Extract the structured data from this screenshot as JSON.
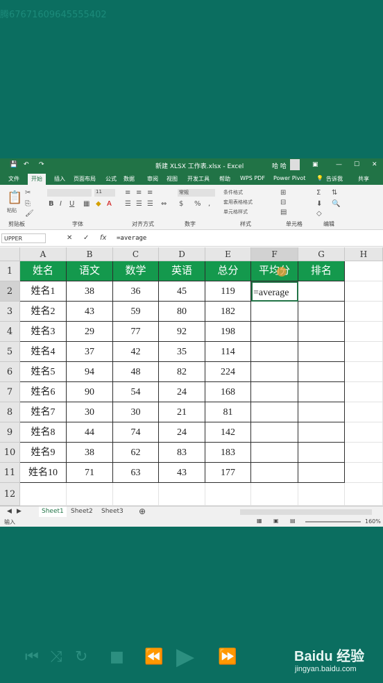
{
  "watermark_top": "腾6767160964555540​2",
  "window": {
    "title": "新建 XLSX 工作表.xlsx - Excel",
    "user": "哈 哈",
    "controls": [
      "—",
      "☐",
      "✕"
    ]
  },
  "ribbon_tabs": [
    "文件",
    "开始",
    "插入",
    "页面布局",
    "公式",
    "数据",
    "审阅",
    "视图",
    "开发工具",
    "帮助",
    "WPS PDF",
    "Power Pivot",
    "告诉我",
    "共享"
  ],
  "ribbon_groups": [
    "剪贴板",
    "字体",
    "对齐方式",
    "数字",
    "样式",
    "单元格",
    "编辑"
  ],
  "ribbon_misc": {
    "font_size": "11",
    "number_format": "常规",
    "conditional": "条件格式",
    "table_format": "套用表格格式",
    "cell_style": "单元格样式",
    "paste": "粘贴"
  },
  "formula_bar": {
    "name_box": "UPPER",
    "cancel": "✕",
    "enter": "✓",
    "fx": "fx",
    "content": "=average"
  },
  "columns": [
    "A",
    "B",
    "C",
    "D",
    "E",
    "F",
    "G",
    "H"
  ],
  "rows": [
    "1",
    "2",
    "3",
    "4",
    "5",
    "6",
    "7",
    "8",
    "9",
    "10",
    "11",
    "12"
  ],
  "table": {
    "headers": [
      "姓名",
      "语文",
      "数学",
      "英语",
      "总分",
      "平均分",
      "排名"
    ],
    "rows": [
      [
        "姓名1",
        "38",
        "36",
        "45",
        "119"
      ],
      [
        "姓名2",
        "43",
        "59",
        "80",
        "182"
      ],
      [
        "姓名3",
        "29",
        "77",
        "92",
        "198"
      ],
      [
        "姓名4",
        "37",
        "42",
        "35",
        "114"
      ],
      [
        "姓名5",
        "94",
        "48",
        "82",
        "224"
      ],
      [
        "姓名6",
        "90",
        "54",
        "24",
        "168"
      ],
      [
        "姓名7",
        "30",
        "30",
        "21",
        "81"
      ],
      [
        "姓名8",
        "44",
        "74",
        "24",
        "142"
      ],
      [
        "姓名9",
        "38",
        "62",
        "83",
        "183"
      ],
      [
        "姓名10",
        "71",
        "63",
        "43",
        "177"
      ]
    ],
    "editing_cell_text": "=average"
  },
  "sheet_tabs": [
    "Sheet1",
    "Sheet2",
    "Sheet3"
  ],
  "add_sheet": "⊕",
  "status": {
    "mode": "输入",
    "zoom": "160%"
  },
  "branding": {
    "logo": "Baidu 经验",
    "url": "jingyan.baidu.com"
  },
  "colors": {
    "background": "#0b6e60",
    "excel_green": "#217346",
    "header_fill": "#14994d"
  }
}
